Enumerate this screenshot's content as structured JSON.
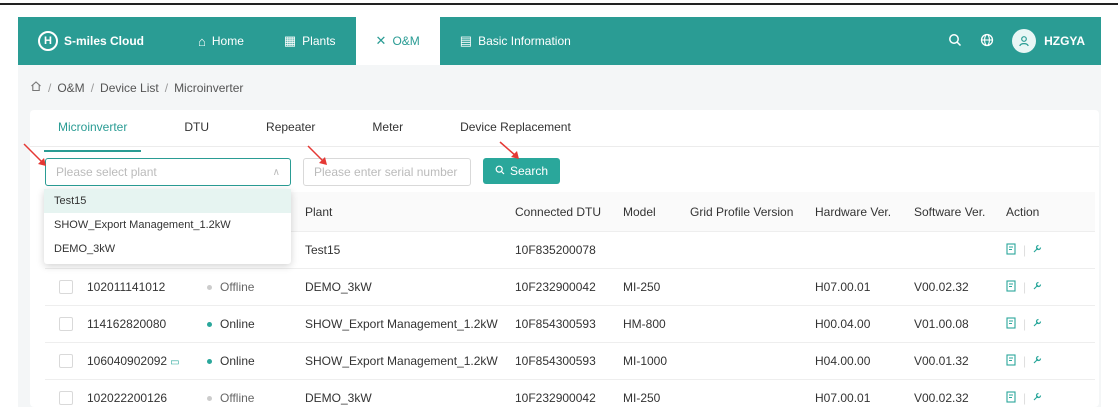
{
  "nav": {
    "brand": "S-miles Cloud",
    "brand_mark": "H",
    "items": [
      {
        "label": "Home",
        "icon": "home-icon",
        "glyph": "⌂"
      },
      {
        "label": "Plants",
        "icon": "plants-icon",
        "glyph": "▦"
      },
      {
        "label": "O&M",
        "icon": "tools-icon",
        "glyph": "✕"
      },
      {
        "label": "Basic Information",
        "icon": "info-icon",
        "glyph": "▤"
      }
    ],
    "user": "HZGYA"
  },
  "breadcrumb": [
    "O&M",
    "Device List",
    "Microinverter"
  ],
  "tabs": [
    "Microinverter",
    "DTU",
    "Repeater",
    "Meter",
    "Device Replacement"
  ],
  "filters": {
    "plant_placeholder": "Please select plant",
    "serial_placeholder": "Please enter serial number",
    "search_label": "Search"
  },
  "dropdown_options": [
    "Test15",
    "SHOW_Export Management_1.2kW",
    "DEMO_3kW"
  ],
  "table": {
    "headers": [
      "",
      "",
      "",
      "Plant",
      "Connected DTU",
      "Model",
      "Grid Profile Version",
      "Hardware Ver.",
      "Software Ver.",
      "Action"
    ],
    "rows": [
      {
        "serial": "",
        "status": "",
        "plant": "Test15",
        "dtu": "10F835200078",
        "model": "",
        "grid": "",
        "hw": "",
        "sw": ""
      },
      {
        "serial": "102011141012",
        "status": "Offline",
        "plant": "DEMO_3kW",
        "dtu": "10F232900042",
        "model": "MI-250",
        "grid": "",
        "hw": "H07.00.01",
        "sw": "V00.02.32"
      },
      {
        "serial": "114162820080",
        "status": "Online",
        "plant": "SHOW_Export Management_1.2kW",
        "dtu": "10F854300593",
        "model": "HM-800",
        "grid": "",
        "hw": "H00.04.00",
        "sw": "V01.00.08"
      },
      {
        "serial": "106040902092",
        "status": "Online",
        "plant": "SHOW_Export Management_1.2kW",
        "dtu": "10F854300593",
        "model": "MI-1000",
        "grid": "",
        "hw": "H04.00.00",
        "sw": "V00.01.32"
      },
      {
        "serial": "102022200126",
        "status": "Offline",
        "plant": "DEMO_3kW",
        "dtu": "10F232900042",
        "model": "MI-250",
        "grid": "",
        "hw": "H07.00.01",
        "sw": "V00.02.32"
      }
    ]
  },
  "colors": {
    "brand": "#2a9c94",
    "online": "#2aa79b",
    "offline": "#cccccc",
    "arrow": "#e53935"
  }
}
